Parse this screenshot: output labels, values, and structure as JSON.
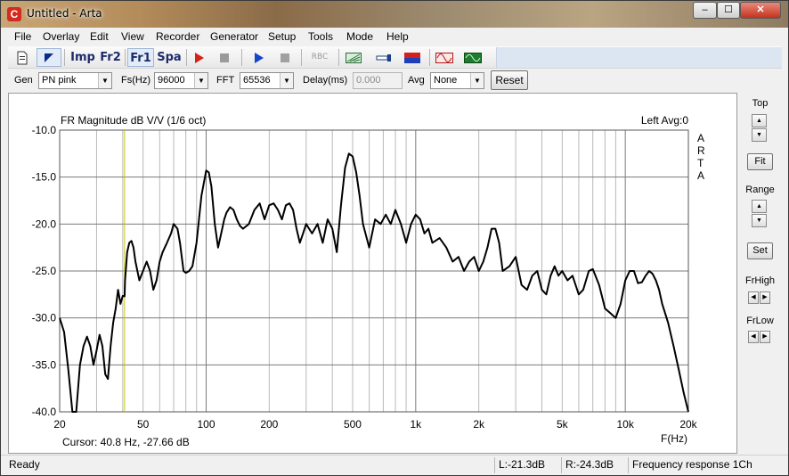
{
  "window": {
    "title": "Untitled - Arta",
    "app_icon_glyph": "C",
    "min_glyph": "–",
    "max_glyph": "☐",
    "close_glyph": "✕"
  },
  "menu": [
    {
      "label": "File"
    },
    {
      "label": "Overlay"
    },
    {
      "label": "Edit"
    },
    {
      "label": "View"
    },
    {
      "label": "Recorder"
    },
    {
      "label": "Generator"
    },
    {
      "label": "Setup"
    },
    {
      "label": "Tools"
    },
    {
      "label": "Mode"
    },
    {
      "label": "Help"
    }
  ],
  "toolbar": {
    "imp": "Imp",
    "fr2": "Fr2",
    "fr1": "Fr1",
    "spa": "Spa",
    "rbc": "RBC",
    "icons": [
      "new-document-icon",
      "edit-cursor-icon",
      "record-red-icon",
      "stop-icon",
      "play-blue-icon",
      "stop-gray-icon",
      "rbc-icon",
      "calibrate-icon",
      "probe-icon",
      "level-meter-icon",
      "signal-sine-icon",
      "scope-icon"
    ]
  },
  "controls": {
    "gen_label": "Gen",
    "gen_value": "PN pink",
    "fs_label": "Fs(Hz)",
    "fs_value": "96000",
    "fft_label": "FFT",
    "fft_value": "65536",
    "delay_label": "Delay(ms)",
    "delay_value": "0.000",
    "avg_label": "Avg",
    "avg_value": "None",
    "reset_label": "Reset"
  },
  "right_panel": {
    "top_label": "Top",
    "fit_label": "Fit",
    "range_label": "Range",
    "set_label": "Set",
    "frhigh_label": "FrHigh",
    "frlow_label": "FrLow"
  },
  "status": {
    "ready": "Ready",
    "left_level": "L:-21.3dB",
    "right_level": "R:-24.3dB",
    "mode": "Frequency response 1Ch"
  },
  "chart_data": {
    "type": "line",
    "title": "FR Magnitude dB V/V (1/6 oct)",
    "channel_info": "Left  Avg:0",
    "watermark": "ARTA",
    "xlabel": "F(Hz)",
    "ylabel": "",
    "x_scale": "log",
    "xlim": [
      20,
      20000
    ],
    "ylim": [
      -40,
      -10
    ],
    "x_ticks": [
      {
        "v": 20,
        "label": "20"
      },
      {
        "v": 50,
        "label": "50"
      },
      {
        "v": 100,
        "label": "100"
      },
      {
        "v": 200,
        "label": "200"
      },
      {
        "v": 500,
        "label": "500"
      },
      {
        "v": 1000,
        "label": "1k"
      },
      {
        "v": 2000,
        "label": "2k"
      },
      {
        "v": 5000,
        "label": "5k"
      },
      {
        "v": 10000,
        "label": "10k"
      },
      {
        "v": 20000,
        "label": "20k"
      }
    ],
    "y_ticks": [
      {
        "v": -10,
        "label": "-10.0"
      },
      {
        "v": -15,
        "label": "-15.0"
      },
      {
        "v": -20,
        "label": "-20.0"
      },
      {
        "v": -25,
        "label": "-25.0"
      },
      {
        "v": -30,
        "label": "-30.0"
      },
      {
        "v": -35,
        "label": "-35.0"
      },
      {
        "v": -40,
        "label": "-40.0"
      }
    ],
    "grid": true,
    "background": "#ffffff",
    "grid_color": "#b8b8b8",
    "major_grid_color": "#7a7a7a",
    "line_color": "#000000",
    "cursor_color": "#c7c40a",
    "cursor_x": 40.8,
    "cursor_readout": "Cursor:   40.8 Hz, -27.66 dB",
    "series": [
      {
        "x": [
          20,
          21,
          22,
          23,
          24,
          25,
          26,
          27,
          28,
          29,
          30,
          31,
          32,
          33,
          34,
          35,
          36,
          37,
          38,
          39,
          40,
          40.8,
          41,
          42,
          43,
          44,
          45,
          46,
          48,
          50,
          52,
          54,
          56,
          58,
          60,
          62,
          65,
          68,
          70,
          73,
          75,
          78,
          80,
          83,
          86,
          90,
          95,
          100,
          103,
          106,
          110,
          114,
          118,
          122,
          125,
          130,
          135,
          140,
          145,
          150,
          160,
          170,
          180,
          190,
          200,
          210,
          220,
          230,
          240,
          250,
          260,
          270,
          280,
          290,
          300,
          320,
          340,
          360,
          380,
          400,
          420,
          440,
          460,
          480,
          500,
          520,
          540,
          560,
          600,
          640,
          680,
          720,
          760,
          800,
          850,
          900,
          950,
          1000,
          1050,
          1100,
          1150,
          1200,
          1300,
          1400,
          1500,
          1600,
          1700,
          1800,
          1900,
          2000,
          2100,
          2200,
          2300,
          2400,
          2500,
          2600,
          2800,
          3000,
          3200,
          3400,
          3600,
          3800,
          4000,
          4200,
          4400,
          4600,
          4800,
          5000,
          5300,
          5600,
          6000,
          6300,
          6700,
          7000,
          7500,
          8000,
          8500,
          9000,
          9500,
          10000,
          10500,
          11000,
          11500,
          12000,
          12500,
          13000,
          13500,
          14000,
          14500,
          15000,
          16000,
          17000,
          18000,
          19000,
          20000
        ],
        "y": [
          -30.0,
          -31.5,
          -35.5,
          -40.0,
          -40.0,
          -35.0,
          -33.0,
          -32.0,
          -33.0,
          -35.0,
          -33.5,
          -31.8,
          -33.0,
          -36.0,
          -36.5,
          -33.0,
          -30.5,
          -29.0,
          -27.0,
          -28.5,
          -27.66,
          -27.7,
          -26.0,
          -23.0,
          -22.0,
          -21.8,
          -22.5,
          -24.0,
          -26.0,
          -25.0,
          -24.0,
          -25.0,
          -27.0,
          -26.0,
          -24.0,
          -23.0,
          -22.0,
          -21.0,
          -20.0,
          -20.5,
          -22.0,
          -25.0,
          -25.2,
          -25.0,
          -24.5,
          -22.0,
          -17.0,
          -14.3,
          -14.5,
          -16.0,
          -20.0,
          -22.5,
          -21.0,
          -19.5,
          -18.8,
          -18.2,
          -18.5,
          -19.5,
          -20.2,
          -20.5,
          -20.0,
          -18.5,
          -17.8,
          -19.5,
          -18.0,
          -17.8,
          -18.5,
          -19.5,
          -18.0,
          -17.8,
          -18.5,
          -20.5,
          -22.0,
          -21.0,
          -20.0,
          -21.0,
          -20.0,
          -22.0,
          -19.5,
          -20.5,
          -23.0,
          -18.0,
          -14.0,
          -12.5,
          -12.8,
          -14.5,
          -17.0,
          -20.0,
          -22.5,
          -19.5,
          -20.0,
          -19.0,
          -20.0,
          -18.5,
          -20.0,
          -22.0,
          -20.0,
          -19.0,
          -19.5,
          -21.0,
          -20.5,
          -22.0,
          -21.5,
          -22.5,
          -24.0,
          -23.5,
          -25.0,
          -24.0,
          -23.5,
          -25.0,
          -24.0,
          -22.5,
          -20.5,
          -20.5,
          -22.0,
          -25.0,
          -24.5,
          -23.5,
          -26.5,
          -27.0,
          -25.5,
          -25.0,
          -27.0,
          -27.5,
          -25.5,
          -24.5,
          -25.5,
          -25.0,
          -26.0,
          -25.5,
          -27.5,
          -27.0,
          -25.0,
          -24.8,
          -26.5,
          -29.0,
          -29.5,
          -30.0,
          -28.5,
          -26.0,
          -25.0,
          -25.0,
          -26.3,
          -26.2,
          -25.5,
          -25.0,
          -25.3,
          -26.0,
          -27.0,
          -28.5,
          -30.5,
          -33.0,
          -35.5,
          -38.0,
          -40.0
        ]
      }
    ]
  }
}
